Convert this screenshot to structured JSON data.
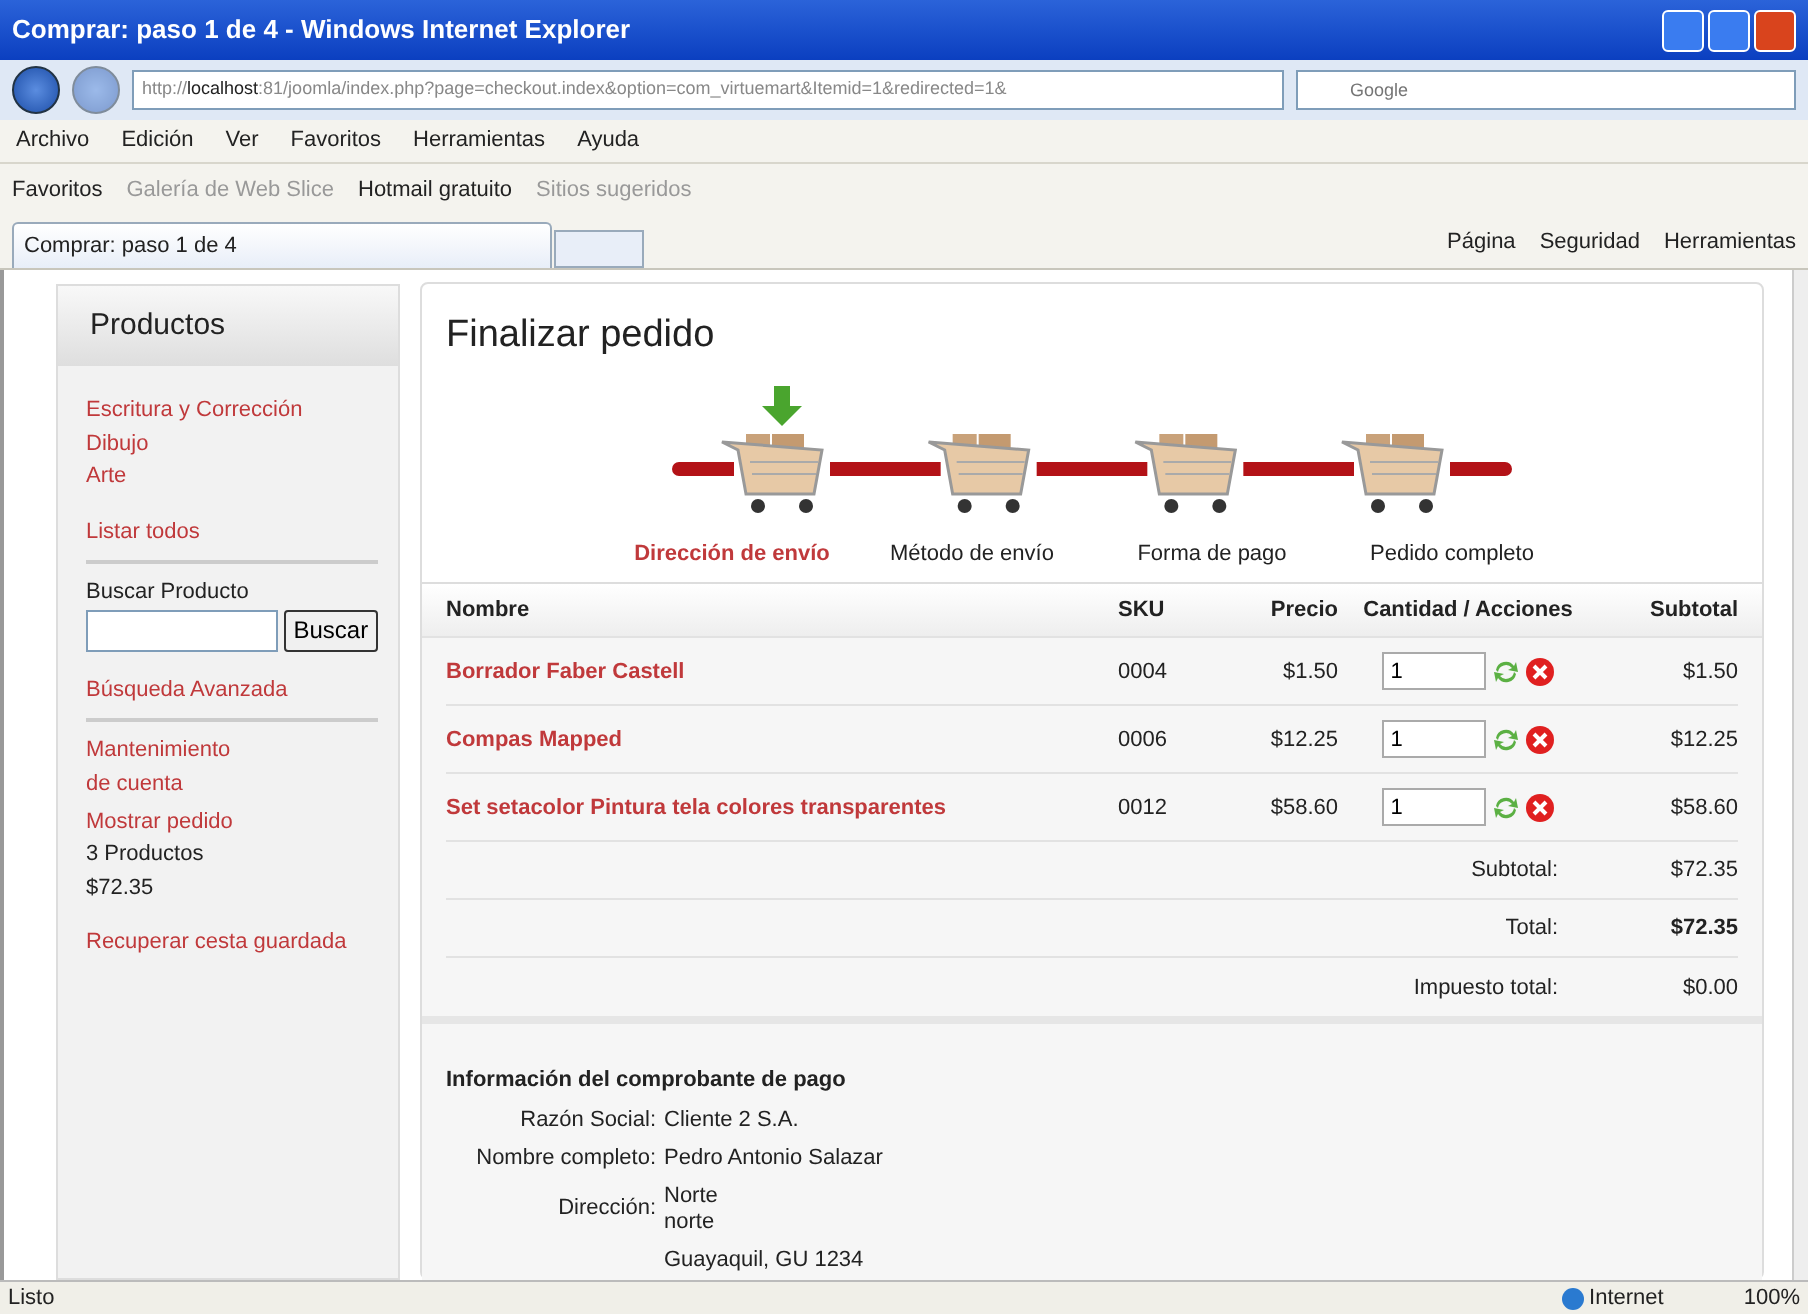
{
  "window": {
    "title": "Comprar: paso 1 de 4 - Windows Internet Explorer"
  },
  "address_bar": {
    "url": "http://**localhost**:81/joomla/index.php?page=checkout.index&option=com_virtuemart&Itemid=1&redirected=1&",
    "search_placeholder": "Google"
  },
  "menu": [
    "Archivo",
    "Edición",
    "Ver",
    "Favoritos",
    "Herramientas",
    "Ayuda"
  ],
  "favorites_bar": [
    {
      "label": "Favoritos",
      "disabled": false
    },
    {
      "label": "Galería de Web Slice",
      "disabled": true
    },
    {
      "label": "Hotmail gratuito",
      "disabled": false
    },
    {
      "label": "Sitios sugeridos",
      "disabled": true
    }
  ],
  "tabs": [
    {
      "label": "Comprar: paso 1 de 4",
      "selected": true
    }
  ],
  "command_bar": [
    "Página",
    "Seguridad",
    "Herramientas"
  ],
  "sidebar": {
    "title": "Productos",
    "categories": [
      "Escritura y Corrección",
      "Dibujo",
      "Arte"
    ],
    "list_all": "Listar todos",
    "search_label": "Buscar Producto",
    "search_button": "Buscar",
    "advanced_search": "Búsqueda Avanzada",
    "account": "Mantenimiento de cuenta",
    "show_order": "Mostrar pedido",
    "cart_count": "3 Productos",
    "cart_total": "$72.35",
    "recover_cart": "Recuperar cesta guardada"
  },
  "main": {
    "title": "Finalizar pedido",
    "steps": [
      {
        "label": "Dirección de envío",
        "selected": true
      },
      {
        "label": "Método de envío",
        "selected": false
      },
      {
        "label": "Forma de pago",
        "selected": false
      },
      {
        "label": "Pedido completo",
        "selected": false
      }
    ],
    "table": {
      "columns": [
        "Nombre",
        "SKU",
        "Precio",
        "Cantidad / Acciones",
        "Subtotal"
      ],
      "rows": [
        {
          "name": "Borrador Faber Castell",
          "sku": "0004",
          "price": "$1.50",
          "quantity": "1",
          "subtotal": "$1.50"
        },
        {
          "name": "Compas Mapped",
          "sku": "0006",
          "price": "$12.25",
          "quantity": "1",
          "subtotal": "$12.25"
        },
        {
          "name": "Set setacolor Pintura tela colores transparentes",
          "sku": "0012",
          "price": "$58.60",
          "quantity": "1",
          "subtotal": "$58.60"
        }
      ],
      "totals": [
        {
          "label": "Subtotal:",
          "value": "$72.35",
          "bold": false
        },
        {
          "label": "Total:",
          "value": "$72.35",
          "bold": true
        },
        {
          "label": "Impuesto total:",
          "value": "$0.00",
          "bold": false
        }
      ]
    },
    "billing": {
      "title": "Información del comprobante de pago",
      "fields": [
        {
          "label": "Razón Social:",
          "lines": [
            "Cliente 2 S.A."
          ]
        },
        {
          "label": "Nombre completo:",
          "lines": [
            "Pedro Antonio Salazar"
          ]
        },
        {
          "label": "Dirección:",
          "lines": [
            "Norte",
            "norte",
            "Guayaquil, GU 1234"
          ]
        }
      ]
    }
  },
  "status_bar": {
    "text": "Listo",
    "zone": "Internet",
    "zoom": "100%"
  }
}
